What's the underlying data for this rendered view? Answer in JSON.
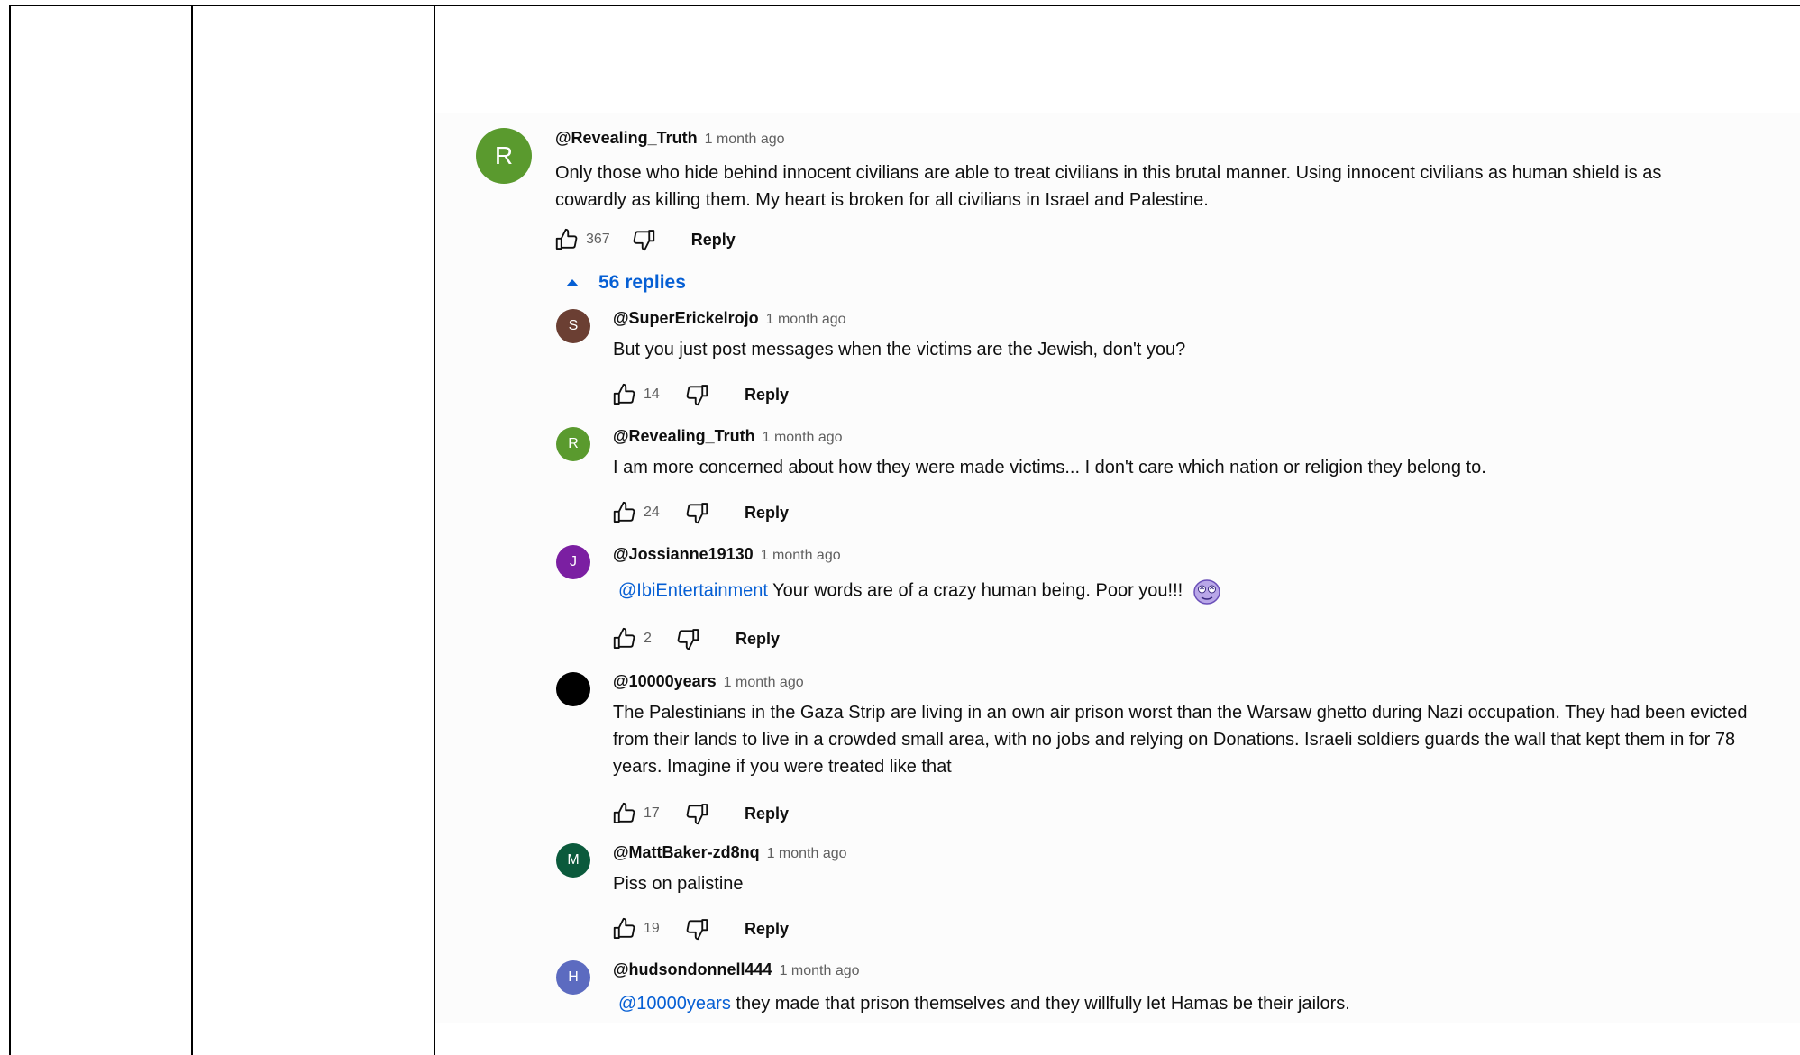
{
  "comment": {
    "avatar_letter": "R",
    "avatar_color": "#5a9a2e",
    "author": "@Revealing_Truth",
    "time": "1 month ago",
    "text": "Only those who hide behind innocent civilians are able to treat civilians in this brutal manner. Using innocent civilians as human shield is as cowardly as killing them. My heart is broken for all civilians in Israel and Palestine.",
    "likes": "367",
    "reply_label": "Reply"
  },
  "replies_toggle": "56 replies",
  "replies": [
    {
      "avatar_letter": "S",
      "avatar_color": "#6b3f33",
      "author": "@SuperErickelrojo",
      "time": "1 month ago",
      "mention": "",
      "text": "But you just post messages when the victims are the Jewish, don't you?",
      "likes": "14",
      "reply_label": "Reply"
    },
    {
      "avatar_letter": "R",
      "avatar_color": "#5a9a2e",
      "author": "@Revealing_Truth",
      "time": "1 month ago",
      "mention": "",
      "text": "I am more concerned about how they were made victims... I don't care which nation or religion they belong to.",
      "likes": "24",
      "reply_label": "Reply"
    },
    {
      "avatar_letter": "J",
      "avatar_color": "#7b1fa2",
      "author": "@Jossianne19130",
      "time": "1 month ago",
      "mention": "@IbiEntertainment",
      "text": "Your words are of a crazy human being. Poor you!!!",
      "likes": "2",
      "reply_label": "Reply"
    },
    {
      "avatar_letter": "",
      "avatar_color": "#000000",
      "author": "@10000years",
      "time": "1 month ago",
      "mention": "",
      "text": "The Palestinians in the Gaza Strip are living in an own air prison worst than the Warsaw ghetto during Nazi occupation. They had been evicted from their lands to live in a crowded small area, with no jobs and relying on Donations. Israeli soldiers guards the wall that kept them in for 78 years. Imagine if you were treated like that",
      "likes": "17",
      "reply_label": "Reply"
    },
    {
      "avatar_letter": "M",
      "avatar_color": "#0b5a3c",
      "author": "@MattBaker-zd8nq",
      "time": "1 month ago",
      "mention": "",
      "text": "Piss on palistine",
      "likes": "19",
      "reply_label": "Reply"
    },
    {
      "avatar_letter": "H",
      "avatar_color": "#5c6bc0",
      "author": "@hudsondonnell444",
      "time": "1 month ago",
      "mention": "@10000years",
      "text": "they made that prison themselves and they willfully let Hamas be their jailors.",
      "likes": "",
      "reply_label": ""
    }
  ],
  "icons": {
    "like": "thumbs-up-icon",
    "dislike": "thumbs-down-icon",
    "toggle": "caret-up-icon",
    "emoji": "dizzy-face-emoji-icon"
  }
}
